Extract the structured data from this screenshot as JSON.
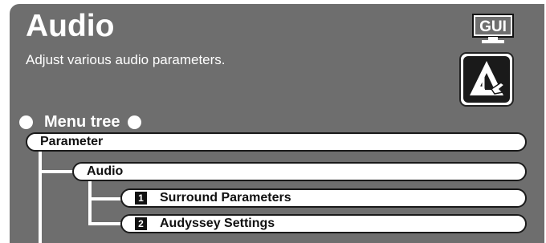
{
  "header": {
    "title": "Audio",
    "subtitle": "Adjust various audio parameters.",
    "gui_badge": "GUI"
  },
  "icons": {
    "gui_badge_icon": "monitor-gui-icon",
    "audio_icon": "audio-note-wrench-icon"
  },
  "menu_tree": {
    "label": "Menu tree",
    "root": "Parameter",
    "child": "Audio",
    "items": [
      {
        "number": "1",
        "label": "Surround Parameters"
      },
      {
        "number": "2",
        "label": "Audyssey Settings"
      }
    ]
  },
  "colors": {
    "panel_bg": "#6e6e6e",
    "text_light": "#ffffff",
    "pill_bg": "#ffffff",
    "pill_border": "#1a1a1a"
  }
}
